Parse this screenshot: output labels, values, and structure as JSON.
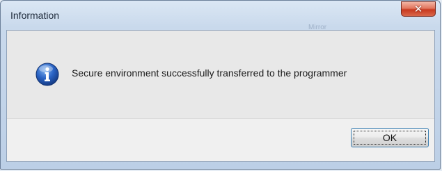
{
  "window": {
    "title": "Information",
    "close_glyph": "✕",
    "background_faded_text": "Mirror"
  },
  "dialog": {
    "icon": "info-icon",
    "message": "Secure environment successfully transferred to the programmer",
    "ok_label": "OK"
  },
  "colors": {
    "close_button": "#c8391f",
    "info_icon_blue": "#1f4fa8",
    "ok_button_border": "#3c7fb1"
  }
}
